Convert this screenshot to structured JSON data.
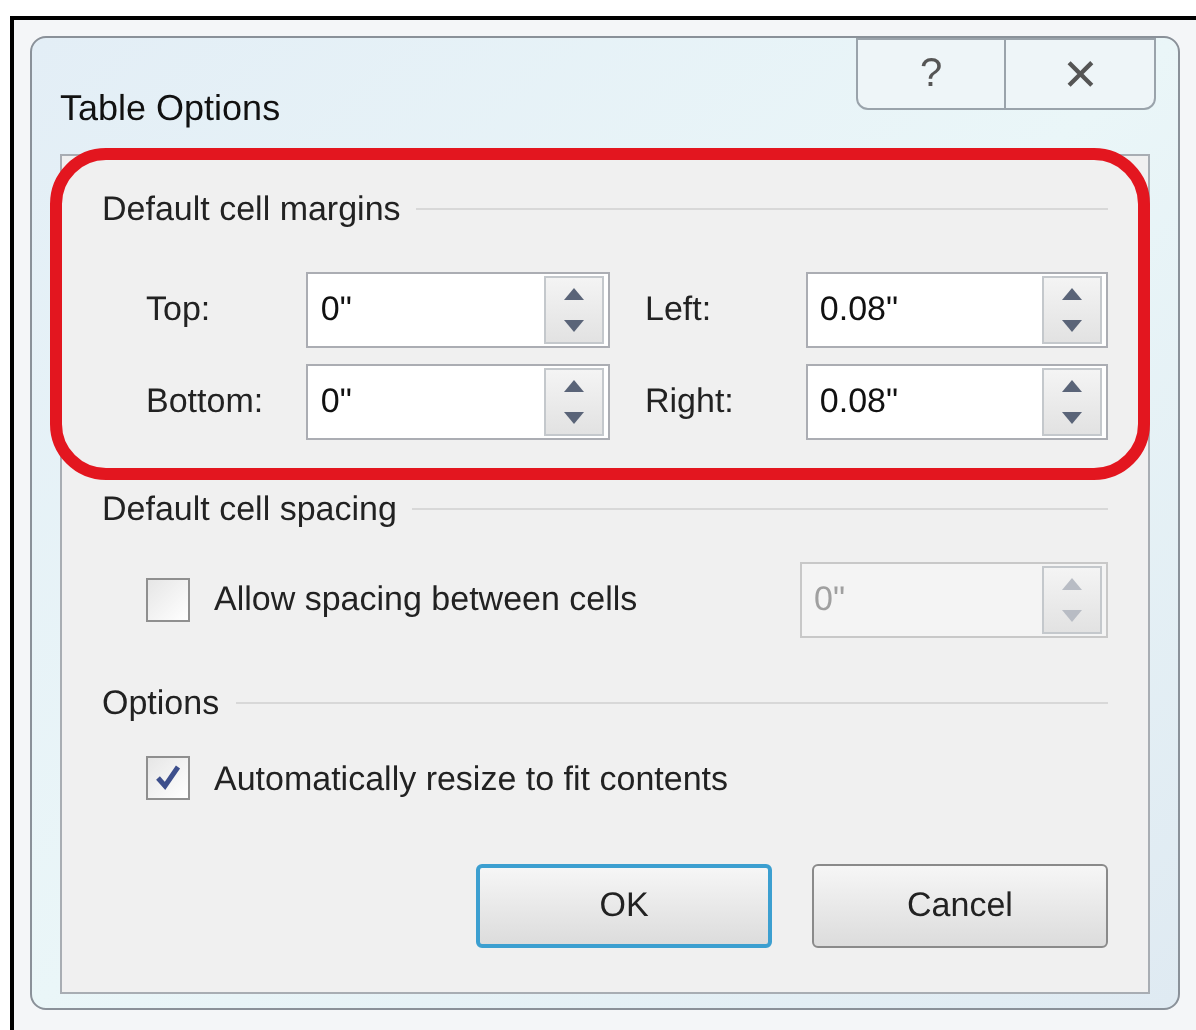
{
  "window": {
    "title": "Table Options",
    "buttons": [
      {
        "kind": "help",
        "label": "?"
      },
      {
        "kind": "close",
        "label": "✕"
      }
    ]
  },
  "margins": {
    "heading": "Default cell margins",
    "highlighted": true,
    "fields": [
      {
        "label": "Top:",
        "value": "0\""
      },
      {
        "label": "Left:",
        "value": "0.08\""
      },
      {
        "label": "Bottom:",
        "value": "0\""
      },
      {
        "label": "Right:",
        "value": "0.08\""
      }
    ]
  },
  "spacing": {
    "heading": "Default cell spacing",
    "checkbox": {
      "label": "Allow spacing between cells",
      "checked": false
    },
    "field": {
      "value": "0\"",
      "disabled": true
    }
  },
  "options": {
    "heading": "Options",
    "checkboxes": [
      {
        "label": "Automatically resize to fit contents",
        "checked": true
      }
    ]
  },
  "buttons": [
    {
      "label": "OK",
      "default": true
    },
    {
      "label": "Cancel",
      "default": false
    }
  ]
}
